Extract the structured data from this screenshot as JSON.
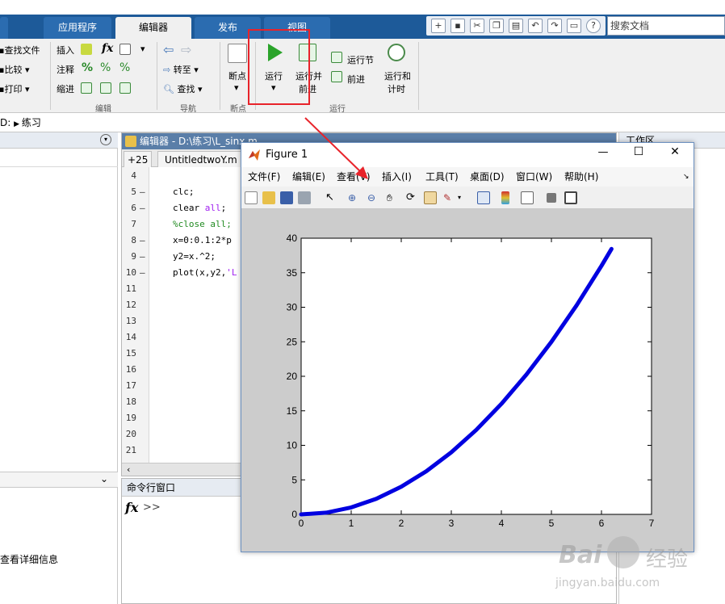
{
  "ribbon_tabs": [
    "应用程序",
    "编辑器",
    "发布",
    "视图"
  ],
  "search_placeholder": "搜索文档",
  "ribbon": {
    "find_files": "查找文件",
    "compare": "比较",
    "print": "打印",
    "insert": "插入",
    "comment": "注释",
    "indent": "缩进",
    "fx": "fx",
    "goto": "转至",
    "find": "查找",
    "breakpoints": "断点",
    "run": "运行",
    "run_advance_1": "运行并",
    "run_advance_2": "前进",
    "run_section": "运行节",
    "advance": "前进",
    "run_time_1": "运行和",
    "run_time_2": "计时",
    "group_edit": "编辑",
    "group_nav": "导航",
    "group_bp": "断点",
    "group_run": "运行"
  },
  "address": {
    "drive": "D:",
    "folder": "练习"
  },
  "editor": {
    "title": "编辑器 - D:\\练习\\L_sinx.m",
    "tab_count": "+25",
    "tab_name": "UntitledtwoY.m",
    "lines": [
      {
        "n": "4",
        "dash": "",
        "code": ""
      },
      {
        "n": "5",
        "dash": "–",
        "code": "clc;"
      },
      {
        "n": "6",
        "dash": "–",
        "code": "clear all;"
      },
      {
        "n": "7",
        "dash": "",
        "code": "%close all;"
      },
      {
        "n": "8",
        "dash": "–",
        "code": "x=0:0.1:2*p"
      },
      {
        "n": "9",
        "dash": "–",
        "code": "y2=x.^2;"
      },
      {
        "n": "10",
        "dash": "–",
        "code": "plot(x,y2,'L"
      },
      {
        "n": "11",
        "dash": "",
        "code": ""
      },
      {
        "n": "12",
        "dash": "",
        "code": ""
      },
      {
        "n": "13",
        "dash": "",
        "code": ""
      },
      {
        "n": "14",
        "dash": "",
        "code": ""
      },
      {
        "n": "15",
        "dash": "",
        "code": ""
      },
      {
        "n": "16",
        "dash": "",
        "code": ""
      },
      {
        "n": "17",
        "dash": "",
        "code": ""
      },
      {
        "n": "18",
        "dash": "",
        "code": ""
      },
      {
        "n": "19",
        "dash": "",
        "code": ""
      },
      {
        "n": "20",
        "dash": "",
        "code": ""
      },
      {
        "n": "21",
        "dash": "",
        "code": ""
      }
    ]
  },
  "command_window": {
    "title": "命令行窗口",
    "prompt": ">>",
    "fx": "fx"
  },
  "left_panel": {
    "details_text": "查看详细信息"
  },
  "workspace": {
    "title": "工作区"
  },
  "figure": {
    "title": "Figure 1",
    "menus": [
      "文件(F)",
      "编辑(E)",
      "查看(V)",
      "插入(I)",
      "工具(T)",
      "桌面(D)",
      "窗口(W)",
      "帮助(H)"
    ],
    "minimize": "—",
    "maximize": "☐",
    "close": "✕"
  },
  "chart_data": {
    "type": "line",
    "x": [
      0,
      0.5,
      1,
      1.5,
      2,
      2.5,
      3,
      3.5,
      4,
      4.5,
      5,
      5.5,
      6,
      6.2
    ],
    "series": [
      {
        "values": [
          0,
          0.25,
          1,
          2.25,
          4,
          6.25,
          9,
          12.25,
          16,
          20.25,
          25,
          30.25,
          36,
          38.44
        ],
        "color": "#0000e0"
      }
    ],
    "xlim": [
      0,
      7
    ],
    "ylim": [
      0,
      40
    ],
    "xticks": [
      0,
      1,
      2,
      3,
      4,
      5,
      6,
      7
    ],
    "yticks": [
      0,
      5,
      10,
      15,
      20,
      25,
      30,
      35,
      40
    ],
    "grid": false
  },
  "colors": {
    "accent_blue": "#1d5a99",
    "highlight_red": "#e8232a",
    "run_green": "#2aa32a",
    "line_blue": "#0000e0"
  },
  "watermark": {
    "brand": "Bai",
    "brand_cn": "经验",
    "url": "jingyan.baidu.com"
  }
}
